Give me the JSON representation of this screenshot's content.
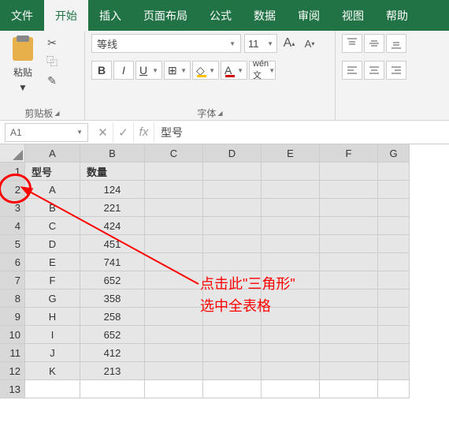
{
  "menu": {
    "tabs": [
      "文件",
      "开始",
      "插入",
      "页面布局",
      "公式",
      "数据",
      "审阅",
      "视图",
      "帮助"
    ],
    "active": 1
  },
  "ribbon": {
    "clipboard": {
      "paste": "粘贴",
      "group": "剪贴板"
    },
    "font": {
      "name": "等线",
      "size": "11",
      "group": "字体",
      "bold": "B",
      "italic": "I",
      "underline": "U",
      "grow": "A",
      "shrink": "A"
    },
    "align": {}
  },
  "namebox": "A1",
  "formula": "型号",
  "fx": "fx",
  "cols": [
    "A",
    "B",
    "C",
    "D",
    "E",
    "F",
    "G"
  ],
  "rows": [
    1,
    2,
    3,
    4,
    5,
    6,
    7,
    8,
    9,
    10,
    11,
    12,
    13
  ],
  "headers": {
    "a": "型号",
    "b": "数量"
  },
  "data": [
    {
      "a": "A",
      "b": "124"
    },
    {
      "a": "B",
      "b": "221"
    },
    {
      "a": "C",
      "b": "424"
    },
    {
      "a": "D",
      "b": "451"
    },
    {
      "a": "E",
      "b": "741"
    },
    {
      "a": "F",
      "b": "652"
    },
    {
      "a": "G",
      "b": "358"
    },
    {
      "a": "H",
      "b": "258"
    },
    {
      "a": "I",
      "b": "652"
    },
    {
      "a": "J",
      "b": "412"
    },
    {
      "a": "K",
      "b": "213"
    }
  ],
  "annotation": {
    "line1": "点击此\"三角形\"",
    "line2": "选中全表格"
  }
}
